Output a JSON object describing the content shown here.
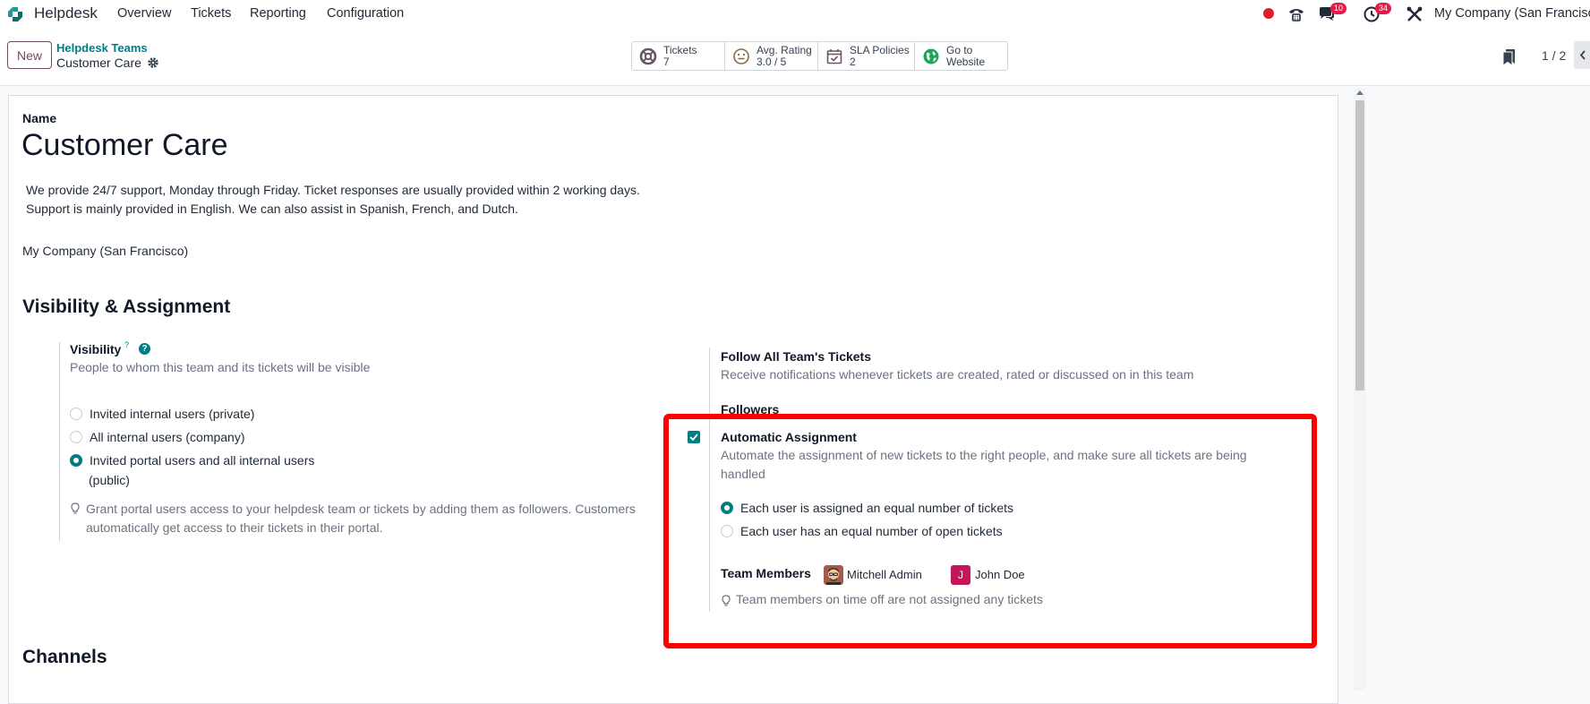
{
  "navbar": {
    "app_name": "Helpdesk",
    "menu": [
      "Overview",
      "Tickets",
      "Reporting",
      "Configuration"
    ],
    "chat_badge": "10",
    "activity_badge": "34",
    "company": "My Company (San Francisco"
  },
  "control_panel": {
    "new_label": "New",
    "breadcrumb_parent": "Helpdesk Teams",
    "breadcrumb_current": "Customer Care",
    "smart_buttons": [
      {
        "label": "Tickets",
        "value": "7"
      },
      {
        "label": "Avg. Rating",
        "value": "3.0 / 5"
      },
      {
        "label": "SLA Policies",
        "value": "2"
      },
      {
        "label": "Go to",
        "value": "Website"
      }
    ],
    "pager": "1 / 2"
  },
  "form": {
    "name_label": "Name",
    "name": "Customer Care",
    "description_line1": "We provide 24/7 support, Monday through Friday. Ticket responses are usually provided within 2 working days.",
    "description_line2": "Support is mainly provided in English. We can also assist in Spanish, French, and Dutch.",
    "company": "My Company (San Francisco)",
    "section_visibility": "Visibility & Assignment",
    "visibility": {
      "title": "Visibility",
      "tooltip_mark": "?",
      "help_mark": "?",
      "desc": "People to whom this team and its tickets will be visible",
      "options": [
        "Invited internal users (private)",
        "All internal users (company)",
        "Invited portal users and all internal users"
      ],
      "option3_cont": "(public)",
      "hint_line1": "Grant portal users access to your helpdesk team or tickets by adding them as followers. Customers",
      "hint_line2": "automatically get access to their tickets in their portal."
    },
    "follow": {
      "title": "Follow All Team's Tickets",
      "desc": "Receive notifications whenever tickets are created, rated or discussed on in this team"
    },
    "followers_label": "Followers",
    "auto_assign": {
      "title": "Automatic Assignment",
      "desc_line1": "Automate the assignment of new tickets to the right people, and make sure all tickets are being",
      "desc_line2": "handled",
      "options": [
        "Each user is assigned an equal number of tickets",
        "Each user has an equal number of open tickets"
      ],
      "team_members_label": "Team Members",
      "members": [
        "Mitchell Admin",
        "John Doe"
      ],
      "member2_initial": "J",
      "hint": "Team members on time off are not assigned any tickets"
    },
    "section_channels": "Channels"
  },
  "colors": {
    "accent": "#017e84",
    "brand": "#714b67",
    "highlight": "#ff0000"
  }
}
